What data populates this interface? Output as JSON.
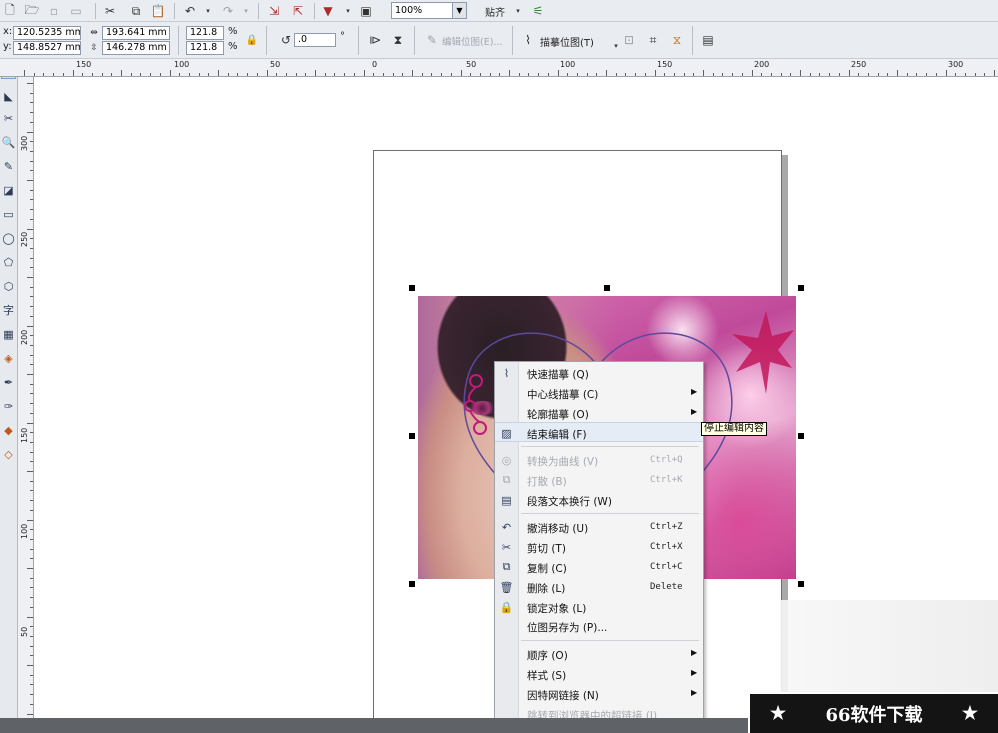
{
  "toolbar": {
    "zoom": "100%",
    "snap_label": "贴齐",
    "x_label": "x:",
    "y_label": "y:",
    "x_value": "120.5235 mm",
    "y_value": "148.8527 mm",
    "width_value": "193.641 mm",
    "height_value": "146.278 mm",
    "scale_x": "121.8",
    "scale_y": "121.8",
    "percent": "%",
    "rotation": ".0",
    "degree": "°",
    "edit_bitmap": "编辑位图(E)...",
    "trace_bitmap": "描摹位图(T)"
  },
  "ruler": {
    "h_labels": [
      "150",
      "100",
      "50",
      "0",
      "50",
      "100",
      "150",
      "200",
      "250",
      "300"
    ],
    "v_labels": [
      "300",
      "250",
      "200",
      "150",
      "100",
      "50"
    ]
  },
  "context_menu": {
    "items": [
      {
        "label": "快速描摹 (Q)",
        "icon": "quick-trace-icon",
        "shortcut": "",
        "submenu": false,
        "disabled": false
      },
      {
        "label": "中心线描摹 (C)",
        "icon": "",
        "shortcut": "",
        "submenu": true,
        "disabled": false
      },
      {
        "label": "轮廓描摹 (O)",
        "icon": "",
        "shortcut": "",
        "submenu": true,
        "disabled": false
      },
      {
        "label": "结束编辑 (F)",
        "icon": "finish-edit-icon",
        "shortcut": "",
        "submenu": false,
        "disabled": false,
        "highlighted": true
      },
      {
        "label": "转换为曲线 (V)",
        "icon": "convert-curve-icon",
        "shortcut": "Ctrl+Q",
        "submenu": false,
        "disabled": true
      },
      {
        "label": "打散 (B)",
        "icon": "break-apart-icon",
        "shortcut": "Ctrl+K",
        "submenu": false,
        "disabled": true
      },
      {
        "label": "段落文本换行 (W)",
        "icon": "text-wrap-icon",
        "shortcut": "",
        "submenu": false,
        "disabled": false
      },
      {
        "label": "撤消移动 (U)",
        "icon": "undo-icon",
        "shortcut": "Ctrl+Z",
        "submenu": false,
        "disabled": false
      },
      {
        "label": "剪切 (T)",
        "icon": "scissors-icon",
        "shortcut": "Ctrl+X",
        "submenu": false,
        "disabled": false
      },
      {
        "label": "复制 (C)",
        "icon": "copy-icon",
        "shortcut": "Ctrl+C",
        "submenu": false,
        "disabled": false
      },
      {
        "label": "删除 (L)",
        "icon": "trash-icon",
        "shortcut": "Delete",
        "submenu": false,
        "disabled": false
      },
      {
        "label": "锁定对象 (L)",
        "icon": "lock-icon",
        "shortcut": "",
        "submenu": false,
        "disabled": false
      },
      {
        "label": "位图另存为 (P)...",
        "icon": "",
        "shortcut": "",
        "submenu": false,
        "disabled": false
      },
      {
        "label": "顺序 (O)",
        "icon": "",
        "shortcut": "",
        "submenu": true,
        "disabled": false
      },
      {
        "label": "样式 (S)",
        "icon": "",
        "shortcut": "",
        "submenu": true,
        "disabled": false
      },
      {
        "label": "因特网链接 (N)",
        "icon": "",
        "shortcut": "",
        "submenu": true,
        "disabled": false
      },
      {
        "label": "跳转到浏览器中的超链接 (J)",
        "icon": "",
        "shortcut": "",
        "submenu": false,
        "disabled": true
      }
    ]
  },
  "tooltip": "停止编辑内容",
  "watermark": {
    "text": "66软件下载",
    "star": "★"
  }
}
